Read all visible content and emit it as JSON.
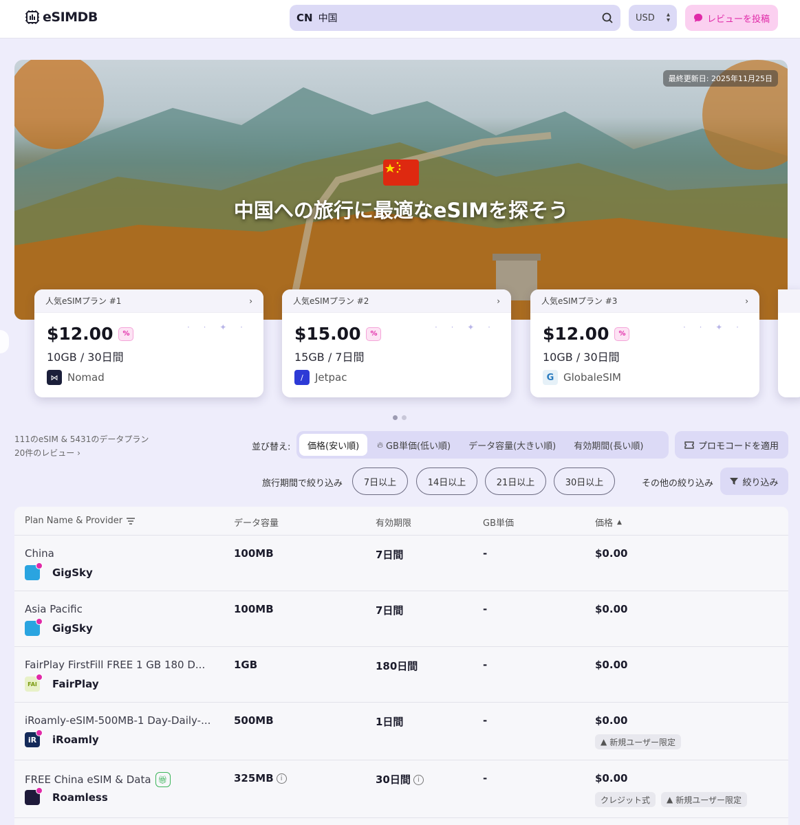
{
  "header": {
    "logo_text": "eSIMDB",
    "search_country_code": "CN",
    "search_value": "中国",
    "currency": "USD",
    "review_button": "レビューを投稿"
  },
  "hero": {
    "updated": "最終更新日: 2025年11月25日",
    "title": "中国への旅行に最適なeSIMを探そう"
  },
  "popular_plans": [
    {
      "label": "人気eSIMプラン #1",
      "price": "$12.00",
      "spec": "10GB / 30日間",
      "provider": "Nomad"
    },
    {
      "label": "人気eSIMプラン #2",
      "price": "$15.00",
      "spec": "15GB / 7日間",
      "provider": "Jetpac"
    },
    {
      "label": "人気eSIMプラン #3",
      "price": "$12.00",
      "spec": "10GB / 30日間",
      "provider": "GlobaleSIM"
    }
  ],
  "summary": {
    "counts": "111のeSIM & 5431のデータプラン",
    "reviews": "20件のレビュー"
  },
  "sort": {
    "label": "並び替え:",
    "options": [
      "価格(安い順)",
      "GB単価(低い順)",
      "データ容量(大きい順)",
      "有効期間(長い順)"
    ],
    "promo": "プロモコードを適用"
  },
  "filters": {
    "duration_label": "旅行期間で絞り込み",
    "durations": [
      "7日以上",
      "14日以上",
      "21日以上",
      "30日以上"
    ],
    "other_label": "その他の絞り込み",
    "filter_button": "絞り込み"
  },
  "table": {
    "headers": [
      "Plan Name & Provider",
      "データ容量",
      "有効期限",
      "GB単価",
      "価格"
    ],
    "rows": [
      {
        "plan": "China",
        "provider": "GigSky",
        "data": "100MB",
        "validity": "7日間",
        "per_gb": "-",
        "price": "$0.00"
      },
      {
        "plan": "Asia Pacific",
        "provider": "GigSky",
        "data": "100MB",
        "validity": "7日間",
        "per_gb": "-",
        "price": "$0.00"
      },
      {
        "plan": "FairPlay FirstFill FREE 1 GB 180 D...",
        "provider": "FairPlay",
        "data": "1GB",
        "validity": "180日間",
        "per_gb": "-",
        "price": "$0.00"
      },
      {
        "plan": "iRoamly-eSIM-500MB-1 Day-Daily-...",
        "provider": "iRoamly",
        "data": "500MB",
        "validity": "1日間",
        "per_gb": "-",
        "price": "$0.00",
        "tag1": "新規ユーザー限定"
      },
      {
        "plan": "FREE China eSIM & Data",
        "provider": "Roamless",
        "data": "325MB",
        "validity": "30日間",
        "per_gb": "-",
        "price": "$0.00",
        "tag1": "クレジット式",
        "tag2": "新規ユーザー限定"
      }
    ]
  },
  "colors": {
    "accent_pink": "#e02aa8",
    "lavender": "#dcdaf6",
    "background": "#eeedfb"
  }
}
